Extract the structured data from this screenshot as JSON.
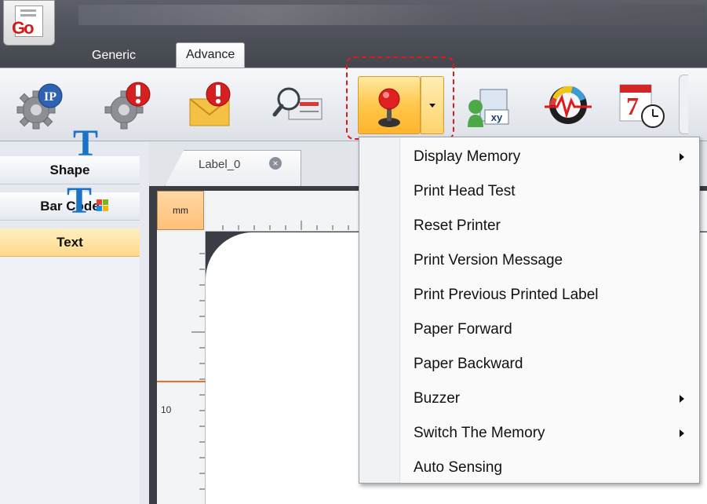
{
  "tabs": [
    {
      "label": "Generic"
    },
    {
      "label": "Advance"
    }
  ],
  "ribbon": {
    "buttons": [
      {
        "icon": "gear-ip-icon"
      },
      {
        "icon": "gear-alert-icon"
      },
      {
        "icon": "mail-alert-icon"
      },
      {
        "icon": "search-icon"
      },
      {
        "icon": "joystick-icon"
      },
      {
        "icon": "xy-map-icon"
      },
      {
        "icon": "heartbeat-monitor-icon"
      },
      {
        "icon": "calendar-clock-icon"
      }
    ],
    "calendar_day": "7",
    "xy_text": "xy",
    "ip_text": "IP"
  },
  "left_panel": {
    "sections": [
      {
        "label": "Shape"
      },
      {
        "label": "Bar Code"
      },
      {
        "label": "Text"
      }
    ],
    "text_icon_glyph": "T"
  },
  "document": {
    "tab_label": "Label_0",
    "unit": "mm",
    "ruler_mark": "10"
  },
  "context_menu": {
    "items": [
      {
        "label": "Display Memory",
        "submenu": true
      },
      {
        "label": "Print Head Test",
        "submenu": false
      },
      {
        "label": "Reset Printer",
        "submenu": false
      },
      {
        "label": "Print Version Message",
        "submenu": false
      },
      {
        "label": "Print Previous Printed Label",
        "submenu": false
      },
      {
        "label": "Paper Forward",
        "submenu": false
      },
      {
        "label": "Paper Backward",
        "submenu": false
      },
      {
        "label": "Buzzer",
        "submenu": true
      },
      {
        "label": "Switch The Memory",
        "submenu": true
      },
      {
        "label": "Auto Sensing",
        "submenu": false
      }
    ]
  },
  "colors": {
    "highlight_dash": "#e01a1a",
    "selected_orange": "#ffc74a",
    "text_icon_blue": "#1a73c8"
  }
}
